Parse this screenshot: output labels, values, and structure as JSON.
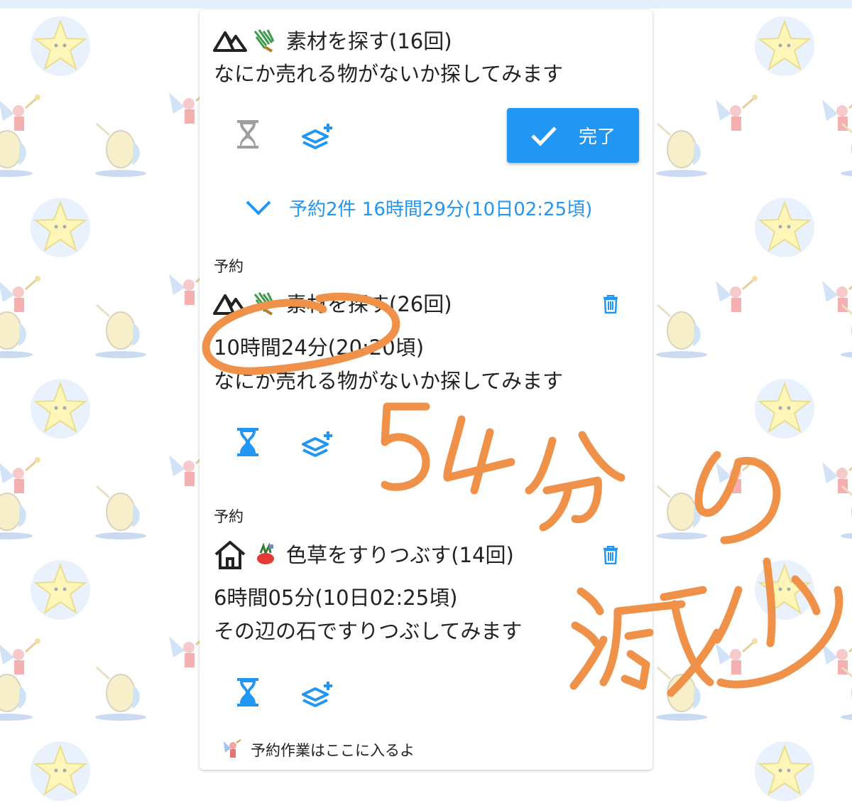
{
  "current_task": {
    "title": "素材を探す(16回)",
    "description": "なにか売れる物がないか探してみます",
    "done_label": "完了"
  },
  "reservation_summary": "予約2件 16時間29分(10日02:25頃)",
  "reservations": [
    {
      "section_label": "予約",
      "title": "素材を探す(26回)",
      "time": "10時間24分(20:20頃)",
      "description": "なにか売れる物がないか探してみます"
    },
    {
      "section_label": "予約",
      "title": "色草をすりつぶす(14回)",
      "time": "6時間05分(10日02:25頃)",
      "description": "その辺の石ですりつぶしてみます"
    }
  ],
  "footer_text": "予約作業はここに入るよ",
  "colors": {
    "accent": "#2196f3",
    "annotation": "#f0914a",
    "hourglass_disabled": "#9e9e9e"
  },
  "icons": {
    "location": [
      "mountain-icon",
      "house-icon"
    ],
    "item": [
      "grass-icon",
      "herb-icon"
    ],
    "actions": [
      "hourglass-icon",
      "layers-plus-icon",
      "check-icon",
      "chevron-down-icon",
      "trash-icon"
    ]
  },
  "handwriting": "54分の減少"
}
